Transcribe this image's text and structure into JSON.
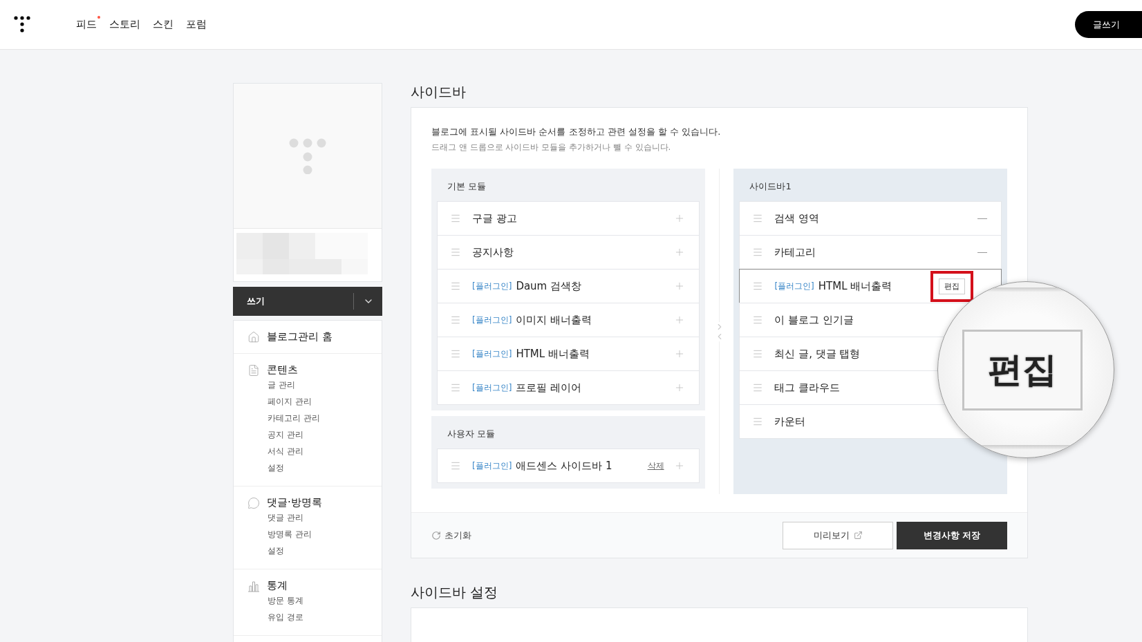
{
  "topbar": {
    "nav": [
      {
        "label": "피드",
        "new": true
      },
      {
        "label": "스토리",
        "new": false
      },
      {
        "label": "스킨",
        "new": false
      },
      {
        "label": "포럼",
        "new": false
      }
    ],
    "write_button": "글쓰기"
  },
  "blog_panel": {
    "write_label": "쓰기"
  },
  "menu": [
    {
      "label": "블로그관리 홈"
    },
    {
      "label": "콘텐츠",
      "children": [
        "글 관리",
        "페이지 관리",
        "카테고리 관리",
        "공지 관리",
        "서식 관리",
        "설정"
      ]
    },
    {
      "label": "댓글·방명록",
      "children": [
        "댓글 관리",
        "방명록 관리",
        "설정"
      ]
    },
    {
      "label": "통계",
      "children": [
        "방문 통계",
        "유입 경로"
      ]
    }
  ],
  "page_title": "사이드바",
  "description": "블로그에 표시될 사이드바 순서를 조정하고 관련 설정을 할 수 있습니다.",
  "hint": "드래그 앤 드롭으로 사이드바 모듈을 추가하거나 뺄 수 있습니다.",
  "module_groups": [
    {
      "title": "기본 모듈",
      "modules": [
        {
          "name": "구글 광고"
        },
        {
          "name": "공지사항"
        },
        {
          "tag": "[플러그인]",
          "name": "Daum 검색창"
        },
        {
          "tag": "[플러그인]",
          "name": "이미지 배너출력"
        },
        {
          "tag": "[플러그인]",
          "name": "HTML 배너출력"
        },
        {
          "tag": "[플러그인]",
          "name": "프로필 레이어"
        }
      ]
    },
    {
      "title": "사용자 모듈",
      "modules": [
        {
          "tag": "[플러그인]",
          "name": "애드센스 사이드바 1",
          "delete_label": "삭제"
        }
      ]
    }
  ],
  "sidebar_column": {
    "title": "사이드바1",
    "modules": [
      {
        "name": "검색 영역",
        "selected": false,
        "removable": true
      },
      {
        "name": "카테고리",
        "selected": false,
        "removable": true
      },
      {
        "tag": "[플러그인]",
        "name": "HTML 배너출력",
        "selected": true,
        "edit_label": "편집",
        "highlighted": true,
        "removable": false
      },
      {
        "name": "이 블로그 인기글",
        "selected": false,
        "removable": false
      },
      {
        "name": "최신 글, 댓글 탭형",
        "selected": false,
        "removable": false
      },
      {
        "name": "태그 클라우드",
        "selected": false,
        "removable": false
      },
      {
        "name": "카운터",
        "selected": false,
        "removable": false
      }
    ]
  },
  "footer": {
    "reset": "초기화",
    "preview": "미리보기",
    "save": "변경사항 저장"
  },
  "magnifier": {
    "text": "편집"
  },
  "settings_title": "사이드바 설정"
}
